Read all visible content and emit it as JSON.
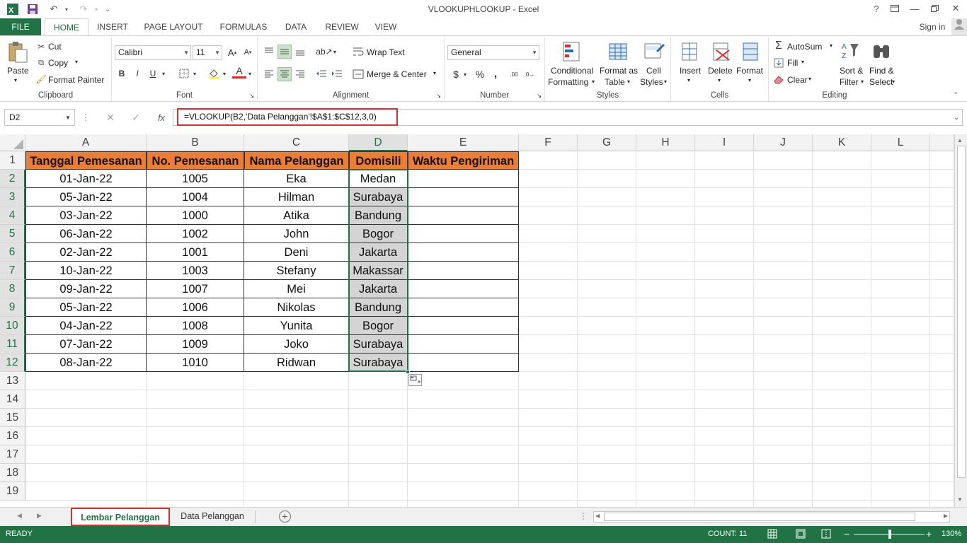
{
  "window": {
    "title": "VLOOKUPHLOOKUP - Excel",
    "help": "?",
    "signin": "Sign in"
  },
  "ribbon_tabs": [
    "FILE",
    "HOME",
    "INSERT",
    "PAGE LAYOUT",
    "FORMULAS",
    "DATA",
    "REVIEW",
    "VIEW"
  ],
  "clipboard": {
    "paste": "Paste",
    "cut": "Cut",
    "copy": "Copy",
    "format_painter": "Format Painter",
    "label": "Clipboard"
  },
  "font": {
    "name": "Calibri",
    "size": "11",
    "bold": "B",
    "italic": "I",
    "underline": "U",
    "font_color": "A",
    "label": "Font"
  },
  "alignment": {
    "wrap": "Wrap Text",
    "merge": "Merge & Center",
    "label": "Alignment"
  },
  "number": {
    "format": "General",
    "currency": "$",
    "percent": "%",
    "comma": ",",
    "inc": ".00",
    "label": "Number"
  },
  "styles": {
    "conditional_1": "Conditional",
    "conditional_2": "Formatting",
    "format_table_1": "Format as",
    "format_table_2": "Table",
    "cell_styles_1": "Cell",
    "cell_styles_2": "Styles",
    "label": "Styles"
  },
  "cells": {
    "insert": "Insert",
    "delete": "Delete",
    "format": "Format",
    "label": "Cells"
  },
  "editing": {
    "autosum": "AutoSum",
    "fill": "Fill",
    "clear": "Clear",
    "sort_1": "Sort &",
    "sort_2": "Filter",
    "find_1": "Find &",
    "find_2": "Select",
    "label": "Editing"
  },
  "formula_bar": {
    "name_box": "D2",
    "fx": "fx",
    "formula": "=VLOOKUP(B2,'Data Pelanggan'!$A$1:$C$12,3,0)"
  },
  "columns": [
    "A",
    "B",
    "C",
    "D",
    "E",
    "F",
    "G",
    "H",
    "I",
    "J",
    "K",
    "L"
  ],
  "rows": [
    "1",
    "2",
    "3",
    "4",
    "5",
    "6",
    "7",
    "8",
    "9",
    "10",
    "11",
    "12",
    "13",
    "14",
    "15",
    "16",
    "17",
    "18",
    "19"
  ],
  "table": {
    "headers": [
      "Tanggal Pemesanan",
      "No. Pemesanan",
      "Nama Pelanggan",
      "Domisili",
      "Waktu Pengiriman"
    ],
    "rows": [
      [
        "01-Jan-22",
        "1005",
        "Eka",
        "Medan",
        ""
      ],
      [
        "05-Jan-22",
        "1004",
        "Hilman",
        "Surabaya",
        ""
      ],
      [
        "03-Jan-22",
        "1000",
        "Atika",
        "Bandung",
        ""
      ],
      [
        "06-Jan-22",
        "1002",
        "John",
        "Bogor",
        ""
      ],
      [
        "02-Jan-22",
        "1001",
        "Deni",
        "Jakarta",
        ""
      ],
      [
        "10-Jan-22",
        "1003",
        "Stefany",
        "Makassar",
        ""
      ],
      [
        "09-Jan-22",
        "1007",
        "Mei",
        "Jakarta",
        ""
      ],
      [
        "05-Jan-22",
        "1006",
        "Nikolas",
        "Bandung",
        ""
      ],
      [
        "04-Jan-22",
        "1008",
        "Yunita",
        "Bogor",
        ""
      ],
      [
        "07-Jan-22",
        "1009",
        "Joko",
        "Surabaya",
        ""
      ],
      [
        "08-Jan-22",
        "1010",
        "Ridwan",
        "Surabaya",
        ""
      ]
    ]
  },
  "sheets": [
    "Lembar Pelanggan",
    "Data Pelanggan"
  ],
  "status": {
    "ready": "READY",
    "count": "COUNT: 11",
    "zoom": "130%"
  },
  "colors": {
    "excel_green": "#217346",
    "header_orange": "#ed7d31",
    "selection_gray": "#d4d4d4",
    "highlight_red": "#e8282b"
  }
}
